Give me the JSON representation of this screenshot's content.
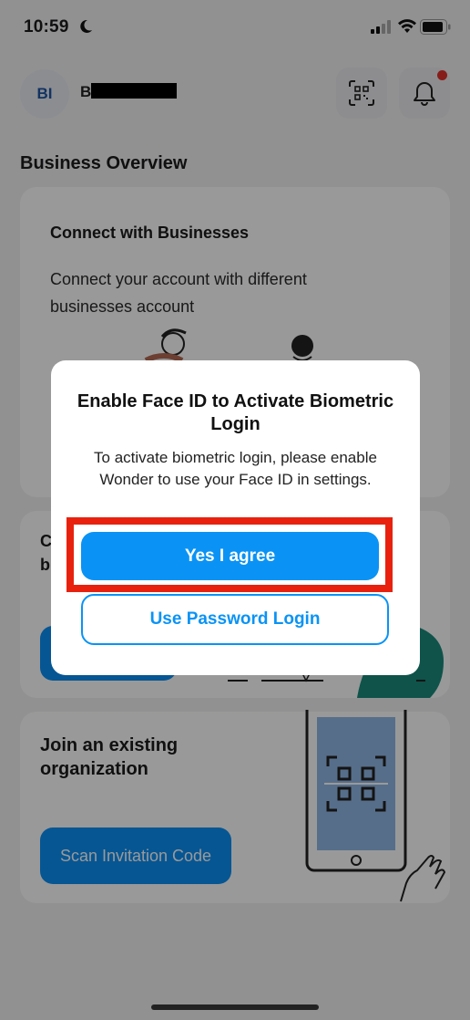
{
  "status_bar": {
    "time": "10:59"
  },
  "header": {
    "avatar_initials": "BI",
    "username": "Bu"
  },
  "overview": {
    "section_title": "Business Overview"
  },
  "card_connect": {
    "title": "Connect with Businesses",
    "description": "Connect your account with different businesses account"
  },
  "card_create": {
    "title": "C\nb"
  },
  "card_join": {
    "title": "Join an existing organization",
    "button_label": "Scan Invitation Code"
  },
  "dialog": {
    "title": "Enable Face ID to Activate Biometric Login",
    "message": "To activate biometric login, please enable Wonder to use your Face ID in settings.",
    "primary_label": "Yes I agree",
    "secondary_label": "Use Password Login"
  },
  "colors": {
    "accent": "#0a93f5",
    "highlight": "#e8210f",
    "notification": "#e0312b"
  }
}
